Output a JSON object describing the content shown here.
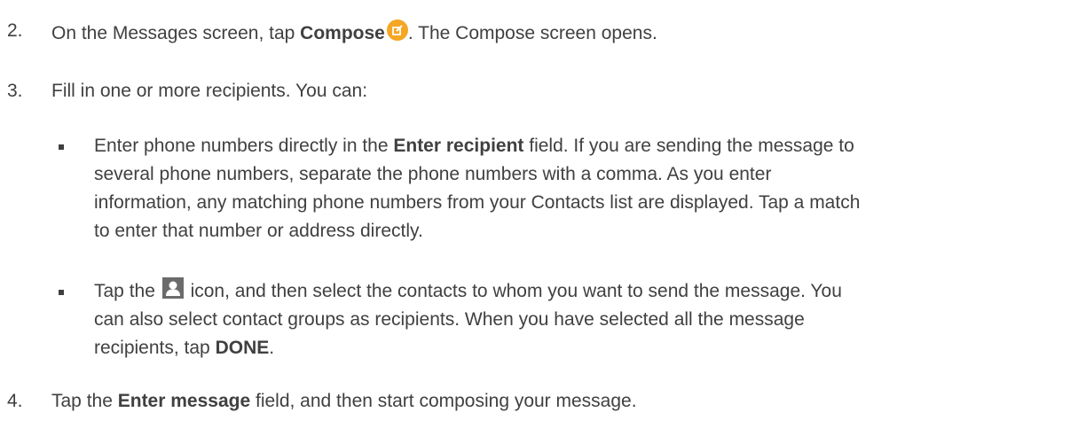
{
  "steps": [
    {
      "number": "2.",
      "pre": "On the Messages screen, tap ",
      "bold": "Compose",
      "post": ". The Compose screen opens.",
      "icon": "compose-icon"
    },
    {
      "number": "3.",
      "text": "Fill in one or more recipients. You can:"
    },
    {
      "number": "4.",
      "pre": "Tap the ",
      "bold": "Enter message",
      "post": " field, and then start composing your message."
    }
  ],
  "bullets": [
    {
      "line1_pre": "Enter phone numbers directly in the ",
      "line1_bold": "Enter recipient",
      "line1_post": " field. If you are sending the message to",
      "line2": "several phone numbers, separate the phone numbers with a comma. As you enter",
      "line3": "information, any matching phone numbers from your Contacts list are displayed. Tap a match",
      "line4": "to enter that number or address directly."
    },
    {
      "line1_pre": "Tap the ",
      "line1_post": " icon, and then select the contacts to whom you want to send the message. You",
      "line2": "can also select contact groups as recipients. When you have selected all the message",
      "line3_pre": "recipients, tap ",
      "line3_bold": "DONE",
      "line3_post": ".",
      "icon": "contact-icon"
    }
  ],
  "colors": {
    "text": "#404040",
    "compose_icon": "#f5a623",
    "contact_icon": "#6b6b6b"
  }
}
